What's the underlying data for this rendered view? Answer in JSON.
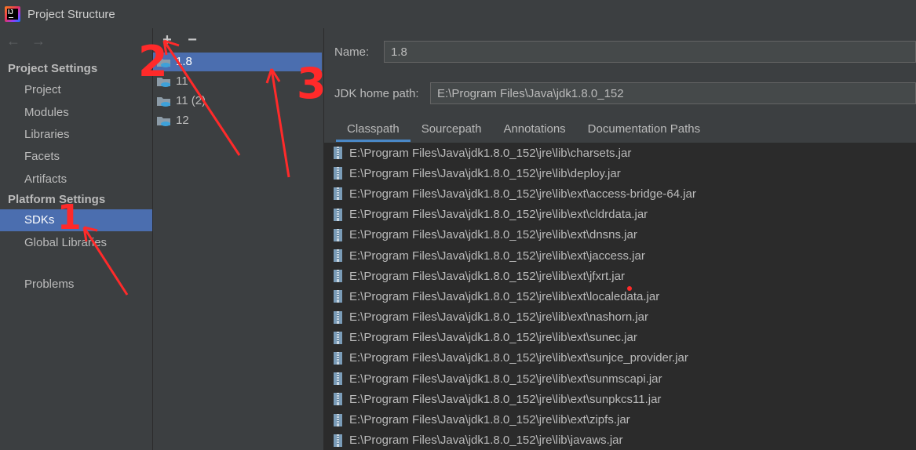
{
  "window": {
    "title": "Project Structure"
  },
  "sidebar": {
    "project_settings_head": "Project Settings",
    "project_items": [
      "Project",
      "Modules",
      "Libraries",
      "Facets",
      "Artifacts"
    ],
    "platform_settings_head": "Platform Settings",
    "platform_items": [
      "SDKs",
      "Global Libraries"
    ],
    "problems": "Problems"
  },
  "sdk_list": {
    "toolbar": {
      "add": "+",
      "remove": "−"
    },
    "items": [
      "1.8",
      "11",
      "11 (2)",
      "12"
    ]
  },
  "detail": {
    "name_label": "Name:",
    "name_value": "1.8",
    "home_label": "JDK home path:",
    "home_value": "E:\\Program Files\\Java\\jdk1.8.0_152",
    "tabs": [
      "Classpath",
      "Sourcepath",
      "Annotations",
      "Documentation Paths"
    ],
    "jars": [
      "E:\\Program Files\\Java\\jdk1.8.0_152\\jre\\lib\\charsets.jar",
      "E:\\Program Files\\Java\\jdk1.8.0_152\\jre\\lib\\deploy.jar",
      "E:\\Program Files\\Java\\jdk1.8.0_152\\jre\\lib\\ext\\access-bridge-64.jar",
      "E:\\Program Files\\Java\\jdk1.8.0_152\\jre\\lib\\ext\\cldrdata.jar",
      "E:\\Program Files\\Java\\jdk1.8.0_152\\jre\\lib\\ext\\dnsns.jar",
      "E:\\Program Files\\Java\\jdk1.8.0_152\\jre\\lib\\ext\\jaccess.jar",
      "E:\\Program Files\\Java\\jdk1.8.0_152\\jre\\lib\\ext\\jfxrt.jar",
      "E:\\Program Files\\Java\\jdk1.8.0_152\\jre\\lib\\ext\\localedata.jar",
      "E:\\Program Files\\Java\\jdk1.8.0_152\\jre\\lib\\ext\\nashorn.jar",
      "E:\\Program Files\\Java\\jdk1.8.0_152\\jre\\lib\\ext\\sunec.jar",
      "E:\\Program Files\\Java\\jdk1.8.0_152\\jre\\lib\\ext\\sunjce_provider.jar",
      "E:\\Program Files\\Java\\jdk1.8.0_152\\jre\\lib\\ext\\sunmscapi.jar",
      "E:\\Program Files\\Java\\jdk1.8.0_152\\jre\\lib\\ext\\sunpkcs11.jar",
      "E:\\Program Files\\Java\\jdk1.8.0_152\\jre\\lib\\ext\\zipfs.jar",
      "E:\\Program Files\\Java\\jdk1.8.0_152\\jre\\lib\\javaws.jar"
    ]
  },
  "annotations": {
    "mark1": "1",
    "mark2": "2",
    "mark3": "3"
  },
  "colors": {
    "selection": "#4b6eaf",
    "background": "#3c3f41",
    "list_bg": "#2b2b2b",
    "annotation": "#ff2a2a"
  }
}
